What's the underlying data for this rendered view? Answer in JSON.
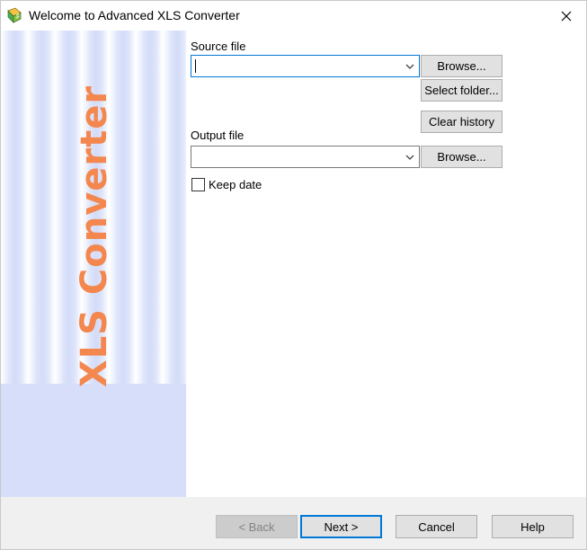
{
  "window": {
    "title": "Welcome to Advanced XLS Converter",
    "app_icon": "xls-converter-app-icon",
    "close_icon": "close-icon"
  },
  "banner": {
    "text": "XLS Converter",
    "text_color": "#f3874e",
    "background_color": "#d6defa"
  },
  "source": {
    "label": "Source file",
    "value": "",
    "browse_label": "Browse...",
    "select_folder_label": "Select folder...",
    "clear_history_label": "Clear history"
  },
  "output": {
    "label": "Output file",
    "value": "",
    "browse_label": "Browse..."
  },
  "keep_date": {
    "label": "Keep date",
    "checked": false
  },
  "nav": {
    "back_label": "< Back",
    "next_label": "Next >",
    "cancel_label": "Cancel",
    "help_label": "Help"
  },
  "colors": {
    "focus_accent": "#0078d7"
  }
}
